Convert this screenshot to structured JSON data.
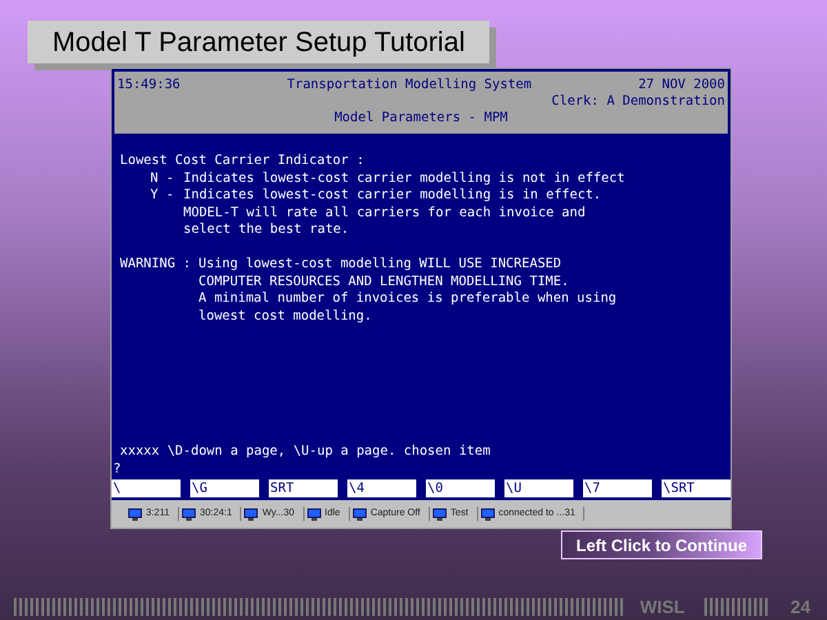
{
  "slide_title": "Model T Parameter Setup Tutorial",
  "terminal": {
    "header": {
      "time": "15:49:36",
      "system": "Transportation Modelling System",
      "date": "27 NOV 2000",
      "clerk": "Clerk: A Demonstration",
      "screen": "Model Parameters - MPM"
    },
    "indicator": {
      "title": "Lowest Cost Carrier Indicator :",
      "options": [
        {
          "code": "N -",
          "lines": [
            "Indicates lowest-cost carrier modelling is not in effect"
          ]
        },
        {
          "code": "Y -",
          "lines": [
            "Indicates lowest-cost carrier modelling is in effect.",
            "MODEL-T will rate all carriers for each invoice and",
            "select the best rate."
          ]
        }
      ]
    },
    "warning": {
      "label": "WARNING :",
      "lines": [
        "Using lowest-cost modelling WILL USE INCREASED",
        "COMPUTER RESOURCES AND LENGTHEN MODELLING TIME.",
        "A minimal number of invoices is preferable when using",
        "lowest cost modelling."
      ]
    },
    "prompt": "xxxxx \\D-down a page, \\U-up a page. chosen item",
    "input": "?",
    "function_keys": [
      "\\",
      "\\G",
      "SRT",
      "\\4",
      "\\0",
      "\\U",
      "\\7",
      "\\SRT"
    ],
    "taskbar": [
      "3:211",
      "30:24:1",
      "Wy...30",
      "Idle",
      "Capture Off",
      "Test",
      "connected to ...31"
    ]
  },
  "continue_button": "Left Click to Continue",
  "footer": {
    "label": "WISL",
    "page": "24"
  }
}
